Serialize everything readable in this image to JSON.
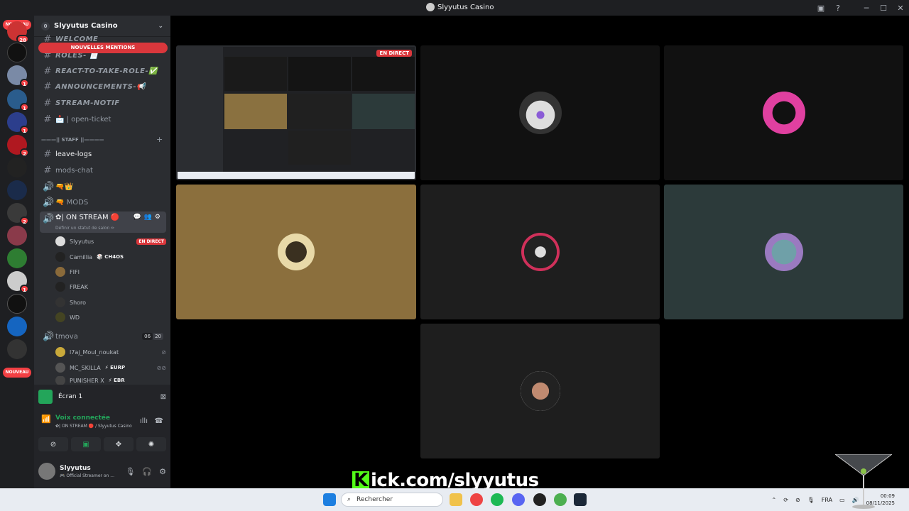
{
  "window": {
    "title": "Slyyutus Casino"
  },
  "servers": {
    "new_label": "NOUVEAU",
    "top_badge": "28",
    "badges": [
      "1",
      "1",
      "1",
      "2",
      "2",
      "1"
    ]
  },
  "guild": {
    "name": "Slyyutus Casino",
    "boost_level": "0",
    "mentions_pill": "NOUVELLES MENTIONS",
    "channels": [
      {
        "name": "WELCOME"
      },
      {
        "name": "ROLES- 📄"
      },
      {
        "name": "REACT-TO-TAKE-ROLE-✅"
      },
      {
        "name": "ANNOUNCEMENTS-📢"
      },
      {
        "name": "STREAM-NOTIF"
      },
      {
        "name": "📩 | open-ticket"
      }
    ],
    "staff_category": "———|| STAFF ||————",
    "staff_channels": [
      {
        "name": "leave-logs"
      },
      {
        "name": "mods-chat"
      },
      {
        "name": "🔫👑"
      },
      {
        "name": "🔫 MODS"
      }
    ],
    "voice_channel": {
      "name": "✿| ON STREAM 🔴",
      "status_hint": "Définir un statut de salon ✏",
      "users": [
        {
          "name": "Slyyutus",
          "badge": "EN DIRECT"
        },
        {
          "name": "Camillia",
          "tag": "🎲 CH4OS"
        },
        {
          "name": "FIFI"
        },
        {
          "name": "FREAK"
        },
        {
          "name": "Shoro"
        },
        {
          "name": "WD"
        }
      ]
    },
    "voice_channel_2": {
      "name": "tmova",
      "count_a": "06",
      "count_b": "20",
      "users": [
        {
          "name": "l7aj_Moul_noukat"
        },
        {
          "name": "MC_SKILLA",
          "tag": "⚡ EURP"
        },
        {
          "name": "PUNISHER X",
          "tag": "⚡ EBR"
        }
      ]
    }
  },
  "panel": {
    "screen_label": "Écran 1",
    "voice_status": "Voix connectée",
    "voice_location": "✿| ON STREAM 🔴 / Slyyutus Casino",
    "user_name": "Slyyutus",
    "user_status": "🎮 Official Streamer on ..."
  },
  "stage": {
    "live_badge": "EN DIRECT"
  },
  "overlay": {
    "kick_text": "ick.com/slyyutus",
    "kick_letter": "K"
  },
  "taskbar": {
    "search_placeholder": "Rechercher",
    "language": "FRA",
    "time": "00:09",
    "date": "08/11/2025"
  },
  "colors": {
    "accent_live": "#da373c",
    "voice_green": "#23a55a",
    "kick_green": "#53fc18"
  }
}
